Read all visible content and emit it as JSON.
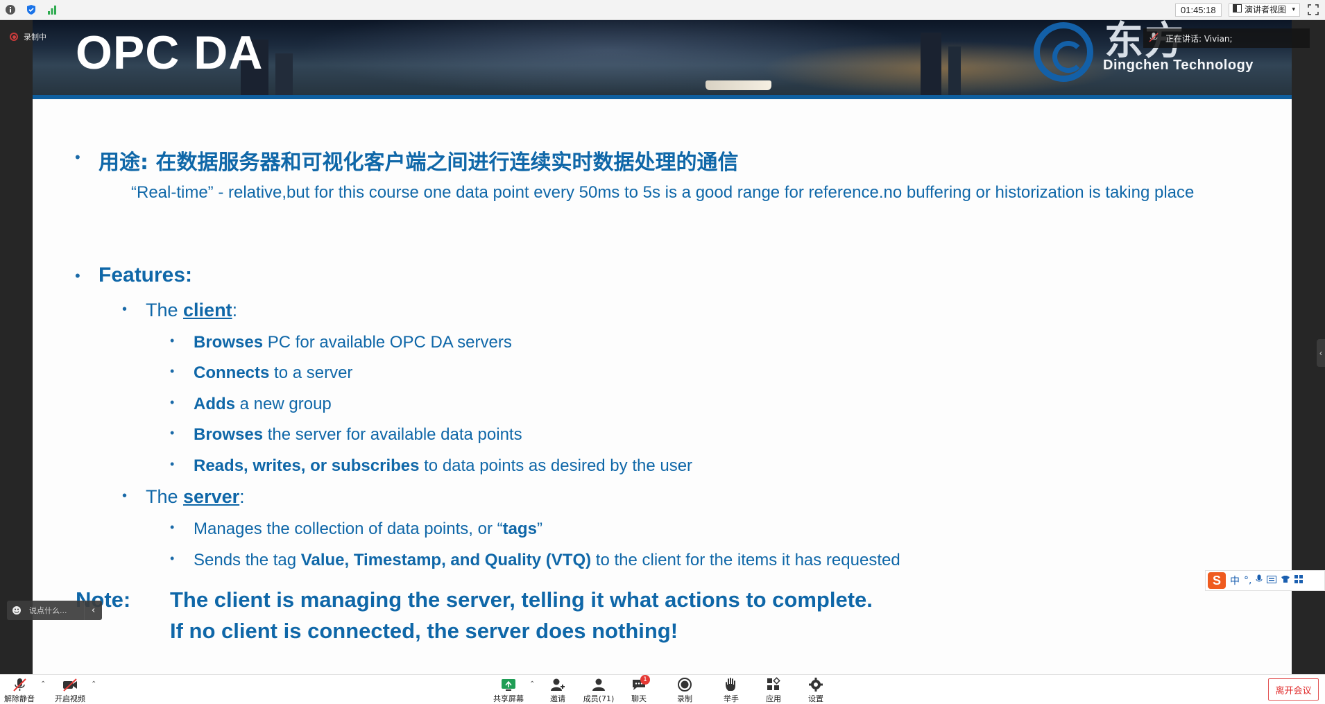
{
  "topbar": {
    "timer": "01:45:18",
    "view_label": "演讲者视图"
  },
  "recording": {
    "label": "录制中"
  },
  "speaking": {
    "label": "正在讲话: Vivian;"
  },
  "slide": {
    "title": "OPC DA",
    "logo_cn": "东方",
    "logo_en": "Dingchen Technology",
    "purpose_label": "用途: 在数据服务器和可视化客户端之间进行连续实时数据处理的通信",
    "realtime_text": "“Real-time” -  relative,but for this course one data point every 50ms to 5s is a good range for reference.no buffering or historization is taking place",
    "features_label": "Features:",
    "client": {
      "prefix": "The ",
      "word": "client",
      "suffix": ":",
      "items": [
        {
          "bold": "Browses",
          "rest": " PC for available OPC DA servers"
        },
        {
          "bold": "Connects",
          "rest": " to a server"
        },
        {
          "bold": "Adds",
          "rest": " a new group"
        },
        {
          "bold": "Browses",
          "rest": " the server for available data points"
        },
        {
          "bold": "Reads, writes, or subscribes",
          "rest": " to data points as desired by the user"
        }
      ]
    },
    "server": {
      "prefix": "The ",
      "word": "server",
      "suffix": ":",
      "item1": {
        "pre": "Manages the collection of data points, or “",
        "bold": "tags",
        "post": "”"
      },
      "item2": {
        "pre": "Sends the tag ",
        "bold": "Value, Timestamp, and Quality (VTQ)",
        "post": " to the client for the items it has requested"
      }
    },
    "note_label": "Note:",
    "note_line1": "The client is managing the server, telling it what actions to complete.",
    "note_line2": "If no client is connected, the server does nothing!"
  },
  "chat": {
    "placeholder": "说点什么..."
  },
  "ime": {
    "lang": "中"
  },
  "bottombar": {
    "unmute": "解除静音",
    "start_video": "开启视频",
    "share_screen": "共享屏幕",
    "invite": "邀请",
    "members": "成员(71)",
    "chat": "聊天",
    "chat_badge": "1",
    "record": "录制",
    "raise_hand": "举手",
    "apps": "应用",
    "settings": "设置",
    "leave": "离开会议"
  }
}
